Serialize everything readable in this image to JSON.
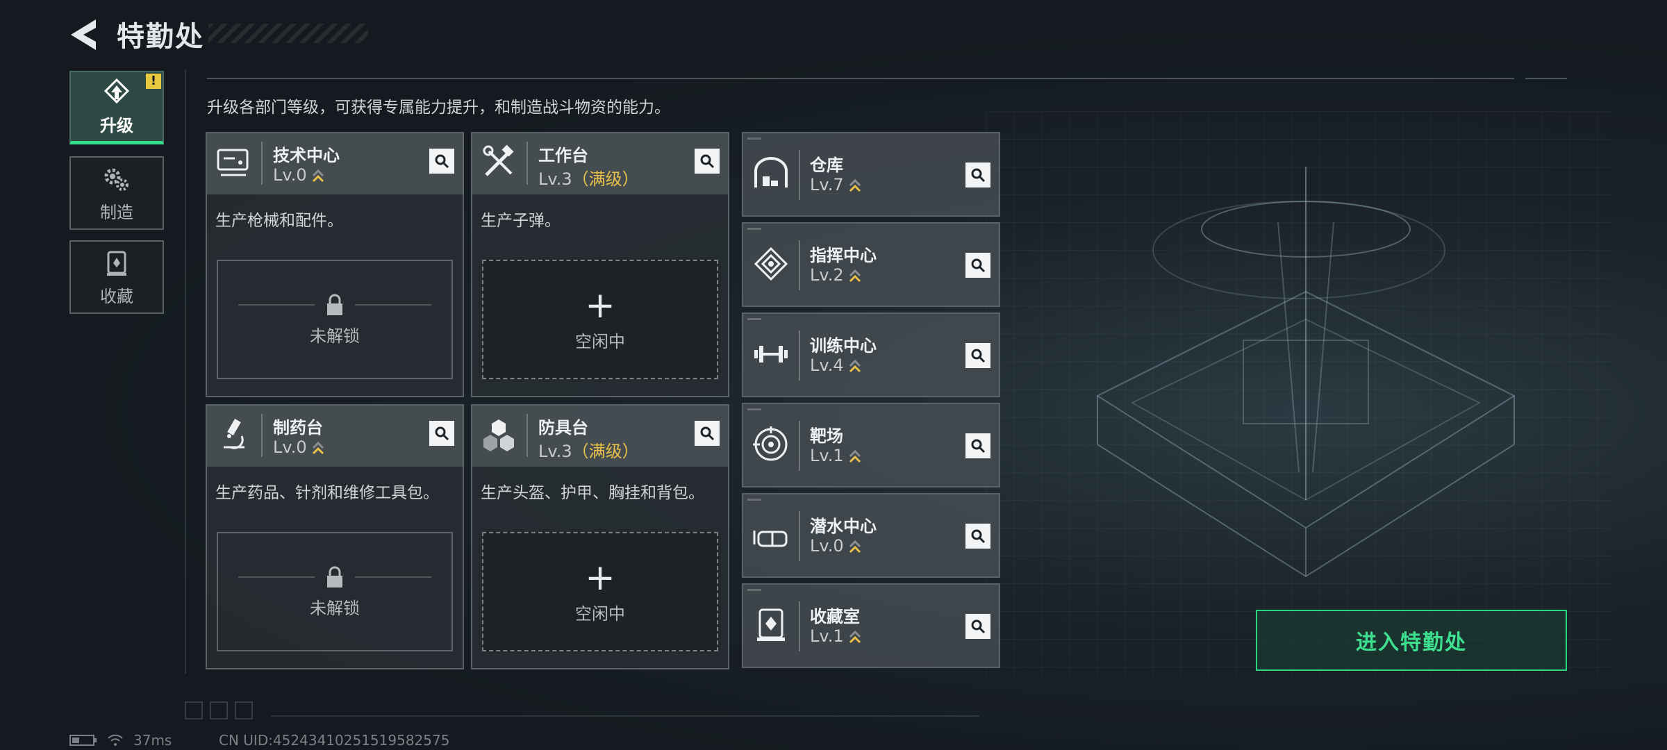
{
  "header": {
    "title": "特勤处"
  },
  "nav": [
    {
      "label": "升级",
      "icon": "upgrade-icon",
      "active": true,
      "badge": "!"
    },
    {
      "label": "制造",
      "icon": "gears-icon",
      "active": false
    },
    {
      "label": "收藏",
      "icon": "collection-icon",
      "active": false
    }
  ],
  "description": "升级各部门等级，可获得专属能力提升，和制造战斗物资的能力。",
  "big_cards": [
    {
      "name": "技术中心",
      "level": "Lv.0",
      "max": "",
      "desc": "生产枪械和配件。",
      "slot": "未解锁",
      "slot_state": "locked",
      "icon": "computer-icon"
    },
    {
      "name": "工作台",
      "level": "Lv.3",
      "max": "（满级）",
      "desc": "生产子弹。",
      "slot": "空闲中",
      "slot_state": "idle",
      "icon": "tools-icon"
    },
    {
      "name": "制药台",
      "level": "Lv.0",
      "max": "",
      "desc": "生产药品、针剂和维修工具包。",
      "slot": "未解锁",
      "slot_state": "locked",
      "icon": "microscope-icon"
    },
    {
      "name": "防具台",
      "level": "Lv.3",
      "max": "（满级）",
      "desc": "生产头盔、护甲、胸挂和背包。",
      "slot": "空闲中",
      "slot_state": "idle",
      "icon": "cubes-icon"
    }
  ],
  "small_cards": [
    {
      "name": "仓库",
      "level": "Lv.7",
      "icon": "warehouse-icon"
    },
    {
      "name": "指挥中心",
      "level": "Lv.2",
      "icon": "command-icon"
    },
    {
      "name": "训练中心",
      "level": "Lv.4",
      "icon": "dumbbell-icon"
    },
    {
      "name": "靶场",
      "level": "Lv.1",
      "icon": "target-icon"
    },
    {
      "name": "潜水中心",
      "level": "Lv.0",
      "icon": "diving-mask-icon"
    },
    {
      "name": "收藏室",
      "level": "Lv.1",
      "icon": "collection-room-icon"
    }
  ],
  "enter_button": "进入特勤处",
  "status": {
    "ping": "37ms",
    "uid": "CN UID:45243410251519582575"
  },
  "colors": {
    "accent_green": "#2ee08a",
    "max_level": "#e8c04a",
    "badge": "#e8c840"
  }
}
